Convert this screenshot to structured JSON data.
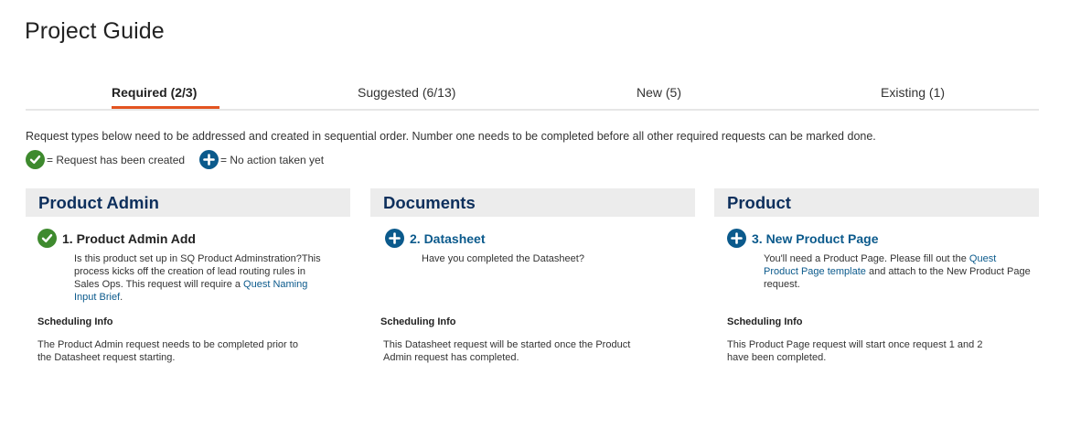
{
  "page_title": "Project Guide",
  "tabs": [
    {
      "label": "Required (2/3)",
      "active": true
    },
    {
      "label": "Suggested (6/13)",
      "active": false
    },
    {
      "label": "New (5)",
      "active": false
    },
    {
      "label": "Existing (1)",
      "active": false
    }
  ],
  "accent_color": "#e35420",
  "intro_text": "Request types below need to be addressed and created in sequential order. Number one needs to be completed before all other required requests can be marked done.",
  "legend": {
    "created": {
      "icon": "check-circle-icon",
      "color": "#3e8a2e",
      "label": "= Request has been created"
    },
    "pending": {
      "icon": "plus-circle-icon",
      "color": "#0b5a8c",
      "label": "= No action taken yet"
    }
  },
  "columns": [
    {
      "header": "Product Admin",
      "request": {
        "title": "1. Product Admin Add",
        "status": "created",
        "desc_pre": "Is this product set up in SQ Product Adminstration?This process kicks off the creation of lead routing rules in Sales Ops. This request will require a ",
        "desc_link": "Quest Naming Input Brief",
        "desc_post": "."
      },
      "scheduling_title": "Scheduling Info",
      "scheduling_text": "The Product Admin request needs to be completed prior to the Datasheet request starting."
    },
    {
      "header": "Documents",
      "request": {
        "title": "2. Datasheet",
        "status": "pending",
        "desc_pre": "Have you completed the Datasheet?",
        "desc_link": "",
        "desc_post": ""
      },
      "scheduling_title": "Scheduling Info",
      "scheduling_text": "This Datasheet request will be started once the Product Admin request has completed."
    },
    {
      "header": "Product",
      "request": {
        "title": "3. New Product Page",
        "status": "pending",
        "desc_pre": "You'll need a Product Page. Please fill out the ",
        "desc_link": "Quest Product Page template",
        "desc_post": " and attach to the New Product Page request."
      },
      "scheduling_title": "Scheduling Info",
      "scheduling_text": "This Product Page request will start once request 1 and 2 have been completed."
    }
  ]
}
